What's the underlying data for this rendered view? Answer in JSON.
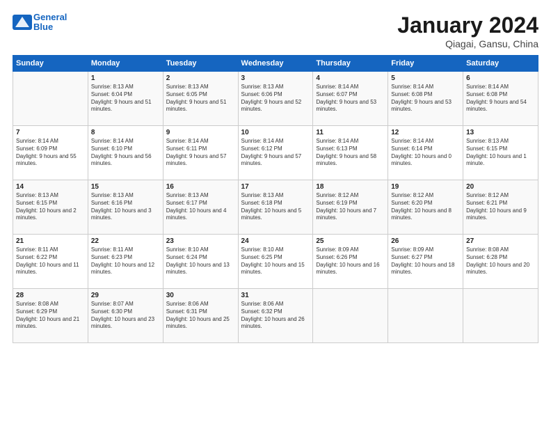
{
  "header": {
    "logo_general": "General",
    "logo_blue": "Blue",
    "title": "January 2024",
    "subtitle": "Qiagai, Gansu, China"
  },
  "weekdays": [
    "Sunday",
    "Monday",
    "Tuesday",
    "Wednesday",
    "Thursday",
    "Friday",
    "Saturday"
  ],
  "weeks": [
    [
      {
        "day": "",
        "sunrise": "",
        "sunset": "",
        "daylight": ""
      },
      {
        "day": "1",
        "sunrise": "Sunrise: 8:13 AM",
        "sunset": "Sunset: 6:04 PM",
        "daylight": "Daylight: 9 hours and 51 minutes."
      },
      {
        "day": "2",
        "sunrise": "Sunrise: 8:13 AM",
        "sunset": "Sunset: 6:05 PM",
        "daylight": "Daylight: 9 hours and 51 minutes."
      },
      {
        "day": "3",
        "sunrise": "Sunrise: 8:13 AM",
        "sunset": "Sunset: 6:06 PM",
        "daylight": "Daylight: 9 hours and 52 minutes."
      },
      {
        "day": "4",
        "sunrise": "Sunrise: 8:14 AM",
        "sunset": "Sunset: 6:07 PM",
        "daylight": "Daylight: 9 hours and 53 minutes."
      },
      {
        "day": "5",
        "sunrise": "Sunrise: 8:14 AM",
        "sunset": "Sunset: 6:08 PM",
        "daylight": "Daylight: 9 hours and 53 minutes."
      },
      {
        "day": "6",
        "sunrise": "Sunrise: 8:14 AM",
        "sunset": "Sunset: 6:08 PM",
        "daylight": "Daylight: 9 hours and 54 minutes."
      }
    ],
    [
      {
        "day": "7",
        "sunrise": "Sunrise: 8:14 AM",
        "sunset": "Sunset: 6:09 PM",
        "daylight": "Daylight: 9 hours and 55 minutes."
      },
      {
        "day": "8",
        "sunrise": "Sunrise: 8:14 AM",
        "sunset": "Sunset: 6:10 PM",
        "daylight": "Daylight: 9 hours and 56 minutes."
      },
      {
        "day": "9",
        "sunrise": "Sunrise: 8:14 AM",
        "sunset": "Sunset: 6:11 PM",
        "daylight": "Daylight: 9 hours and 57 minutes."
      },
      {
        "day": "10",
        "sunrise": "Sunrise: 8:14 AM",
        "sunset": "Sunset: 6:12 PM",
        "daylight": "Daylight: 9 hours and 57 minutes."
      },
      {
        "day": "11",
        "sunrise": "Sunrise: 8:14 AM",
        "sunset": "Sunset: 6:13 PM",
        "daylight": "Daylight: 9 hours and 58 minutes."
      },
      {
        "day": "12",
        "sunrise": "Sunrise: 8:14 AM",
        "sunset": "Sunset: 6:14 PM",
        "daylight": "Daylight: 10 hours and 0 minutes."
      },
      {
        "day": "13",
        "sunrise": "Sunrise: 8:13 AM",
        "sunset": "Sunset: 6:15 PM",
        "daylight": "Daylight: 10 hours and 1 minute."
      }
    ],
    [
      {
        "day": "14",
        "sunrise": "Sunrise: 8:13 AM",
        "sunset": "Sunset: 6:15 PM",
        "daylight": "Daylight: 10 hours and 2 minutes."
      },
      {
        "day": "15",
        "sunrise": "Sunrise: 8:13 AM",
        "sunset": "Sunset: 6:16 PM",
        "daylight": "Daylight: 10 hours and 3 minutes."
      },
      {
        "day": "16",
        "sunrise": "Sunrise: 8:13 AM",
        "sunset": "Sunset: 6:17 PM",
        "daylight": "Daylight: 10 hours and 4 minutes."
      },
      {
        "day": "17",
        "sunrise": "Sunrise: 8:13 AM",
        "sunset": "Sunset: 6:18 PM",
        "daylight": "Daylight: 10 hours and 5 minutes."
      },
      {
        "day": "18",
        "sunrise": "Sunrise: 8:12 AM",
        "sunset": "Sunset: 6:19 PM",
        "daylight": "Daylight: 10 hours and 7 minutes."
      },
      {
        "day": "19",
        "sunrise": "Sunrise: 8:12 AM",
        "sunset": "Sunset: 6:20 PM",
        "daylight": "Daylight: 10 hours and 8 minutes."
      },
      {
        "day": "20",
        "sunrise": "Sunrise: 8:12 AM",
        "sunset": "Sunset: 6:21 PM",
        "daylight": "Daylight: 10 hours and 9 minutes."
      }
    ],
    [
      {
        "day": "21",
        "sunrise": "Sunrise: 8:11 AM",
        "sunset": "Sunset: 6:22 PM",
        "daylight": "Daylight: 10 hours and 11 minutes."
      },
      {
        "day": "22",
        "sunrise": "Sunrise: 8:11 AM",
        "sunset": "Sunset: 6:23 PM",
        "daylight": "Daylight: 10 hours and 12 minutes."
      },
      {
        "day": "23",
        "sunrise": "Sunrise: 8:10 AM",
        "sunset": "Sunset: 6:24 PM",
        "daylight": "Daylight: 10 hours and 13 minutes."
      },
      {
        "day": "24",
        "sunrise": "Sunrise: 8:10 AM",
        "sunset": "Sunset: 6:25 PM",
        "daylight": "Daylight: 10 hours and 15 minutes."
      },
      {
        "day": "25",
        "sunrise": "Sunrise: 8:09 AM",
        "sunset": "Sunset: 6:26 PM",
        "daylight": "Daylight: 10 hours and 16 minutes."
      },
      {
        "day": "26",
        "sunrise": "Sunrise: 8:09 AM",
        "sunset": "Sunset: 6:27 PM",
        "daylight": "Daylight: 10 hours and 18 minutes."
      },
      {
        "day": "27",
        "sunrise": "Sunrise: 8:08 AM",
        "sunset": "Sunset: 6:28 PM",
        "daylight": "Daylight: 10 hours and 20 minutes."
      }
    ],
    [
      {
        "day": "28",
        "sunrise": "Sunrise: 8:08 AM",
        "sunset": "Sunset: 6:29 PM",
        "daylight": "Daylight: 10 hours and 21 minutes."
      },
      {
        "day": "29",
        "sunrise": "Sunrise: 8:07 AM",
        "sunset": "Sunset: 6:30 PM",
        "daylight": "Daylight: 10 hours and 23 minutes."
      },
      {
        "day": "30",
        "sunrise": "Sunrise: 8:06 AM",
        "sunset": "Sunset: 6:31 PM",
        "daylight": "Daylight: 10 hours and 25 minutes."
      },
      {
        "day": "31",
        "sunrise": "Sunrise: 8:06 AM",
        "sunset": "Sunset: 6:32 PM",
        "daylight": "Daylight: 10 hours and 26 minutes."
      },
      {
        "day": "",
        "sunrise": "",
        "sunset": "",
        "daylight": ""
      },
      {
        "day": "",
        "sunrise": "",
        "sunset": "",
        "daylight": ""
      },
      {
        "day": "",
        "sunrise": "",
        "sunset": "",
        "daylight": ""
      }
    ]
  ]
}
